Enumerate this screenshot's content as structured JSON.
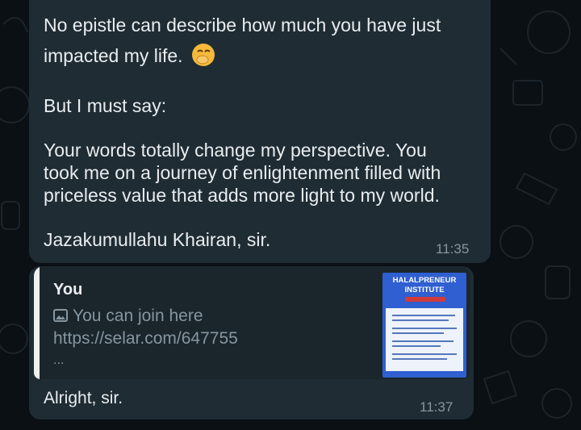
{
  "message1": {
    "lines": [
      "No epistle can describe how much you have just",
      "impacted my life.",
      "But I must say:",
      "Your words totally change my perspective. You",
      "took me on a journey of enlightenment filled with",
      "priceless value that adds more light to my world.",
      "Jazakumullahu Khairan, sir."
    ],
    "emoji": "hand-over-mouth-emoji",
    "time": "11:35"
  },
  "message2": {
    "quote": {
      "sender": "You",
      "icon": "image-icon",
      "text": "You can join here",
      "link": "https://selar.com/647755",
      "ellipsis": "...",
      "thumbnail_title_1": "HALALPRENEUR",
      "thumbnail_title_2": "INSTITUTE"
    },
    "text": "Alright, sir.",
    "time": "11:37"
  },
  "colors": {
    "background": "#0b1014",
    "bubble": "#1f2c34",
    "quote_background": "#1b252c",
    "text": "#e9edef",
    "muted": "#8696a0"
  }
}
